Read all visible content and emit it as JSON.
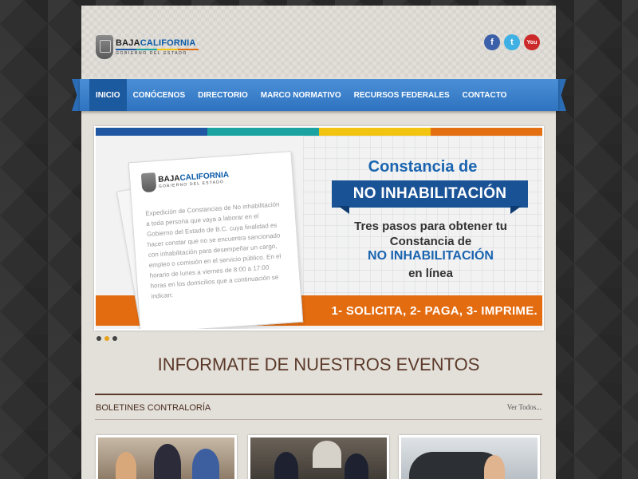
{
  "header": {
    "logo": {
      "brand_baja": "BAJA",
      "brand_california": "CALIFORNIA",
      "subtitle": "GOBIERNO DEL ESTADO"
    },
    "social": [
      {
        "name": "facebook-icon",
        "glyph": "f"
      },
      {
        "name": "twitter-icon",
        "glyph": "t"
      },
      {
        "name": "youtube-icon",
        "glyph": "You"
      }
    ]
  },
  "nav": {
    "items": [
      "INICIO",
      "CONÓCENOS",
      "DIRECTORIO",
      "MARCO NORMATIVO",
      "RECURSOS FEDERALES",
      "CONTACTO"
    ],
    "active": "INICIO"
  },
  "slider": {
    "topbar_colors": [
      "#1f57a3",
      "#1aa3a0",
      "#f2c40f",
      "#e46f10"
    ],
    "doc_logo": {
      "brand_baja": "BAJA",
      "brand_california": "CALIFORNIA",
      "subtitle": "GOBIERNO DEL ESTADO"
    },
    "doc_text": "Expedición de Constancias de No inhabilitación a toda persona que vaya a laborar en el Gobierno del Estado de B.C. cuya finalidad es hacer constar que no se encuentra sancionado con inhabilitación para desempeñar un cargo, empleo o comisión en el servicio público. En el horario de lunes a viernes de 8:00 a 17:00 horas en los domicilios que a continuación se indican:",
    "heading": "Constancia de",
    "ribbon": "NO INHABILITACIÓN",
    "sub1": "Tres pasos para obtener tu Constancia de",
    "sub2": "NO INHABILITACIÓN",
    "sub3": "en línea",
    "steps": "1- SOLICITA, 2- PAGA, 3- IMPRIME.",
    "dots": 3,
    "active_dot": 1
  },
  "events": {
    "title": "INFORMATE DE NUESTROS EVENTOS",
    "boletines": "BOLETINES CONTRALORÍA",
    "ver_todos": "Ver Todos..."
  }
}
